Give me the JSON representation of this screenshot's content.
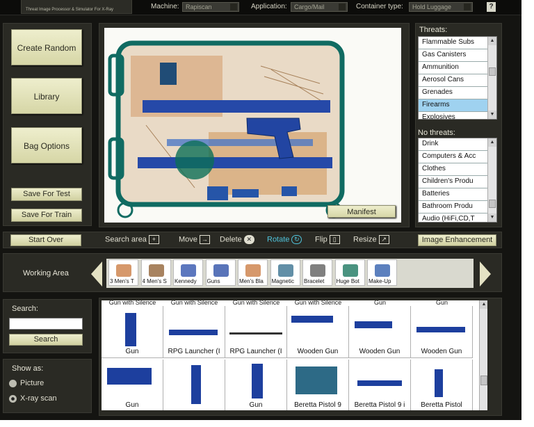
{
  "app": {
    "subtitle": "Threat Image Processor & Simulator For X-Ray"
  },
  "toolbar": {
    "machine_label": "Machine:",
    "machine_value": "Rapiscan",
    "application_label": "Application:",
    "application_value": "Cargo/Mail",
    "container_label": "Container type:",
    "container_value": "Hold Luggage",
    "help_label": "?"
  },
  "left": {
    "create_random": "Create Random",
    "library": "Library",
    "bag_options": "Bag Options",
    "save_for_test": "Save For Test",
    "save_for_train": "Save For Train",
    "start_over": "Start Over"
  },
  "threats": {
    "label": "Threats:",
    "items": [
      "Flammable Subs",
      "Gas Canisters",
      "Ammunition",
      "Aerosol Cans",
      "Grenades",
      "Firearms",
      "Explosives"
    ],
    "selected_index": 5
  },
  "nothreats": {
    "label": "No threats:",
    "items": [
      "Drink",
      "Computers & Acc",
      "Clothes",
      "Children's Produ",
      "Batteries",
      "Bathroom Produ",
      "Audio (HiFi,CD,T"
    ]
  },
  "manifest": "Manifest",
  "tools": {
    "search_area": "Search area",
    "move": "Move",
    "delete": "Delete",
    "rotate": "Rotate",
    "flip": "Flip",
    "resize": "Resize",
    "image_enhancement": "Image Enhancement",
    "rotate_color": "#4fc4dc"
  },
  "working_area": {
    "label": "Working Area",
    "tiles": [
      "3 Men's T",
      "4 Men's S",
      "Kennedy",
      "Guns",
      "Men's Bla",
      "Magnetic",
      "Bracelet",
      "Huge Bot",
      "Make-Up"
    ]
  },
  "search": {
    "label": "Search:",
    "value": "",
    "button": "Search"
  },
  "show_as": {
    "label": "Show as:",
    "picture": "Picture",
    "xray": "X-ray scan",
    "selected": "X-ray scan"
  },
  "results": {
    "top_labels": [
      "Gun with Silence",
      "Gun with Silence",
      "Gun with Silence",
      "Gun with Silence",
      "Gun",
      "Gun"
    ],
    "row1": [
      "Gun",
      "RPG Launcher (I",
      "RPG Launcher (I",
      "Wooden Gun",
      "Wooden Gun",
      "Wooden Gun"
    ],
    "row2": [
      "Gun",
      "",
      "Gun",
      "Beretta Pistol 9",
      "Beretta Pistol 9 i",
      "Beretta Pistol"
    ]
  },
  "colors": {
    "accent_bag": "#2244a6",
    "organic": "#c8763a",
    "frame": "#0f6f6a"
  }
}
